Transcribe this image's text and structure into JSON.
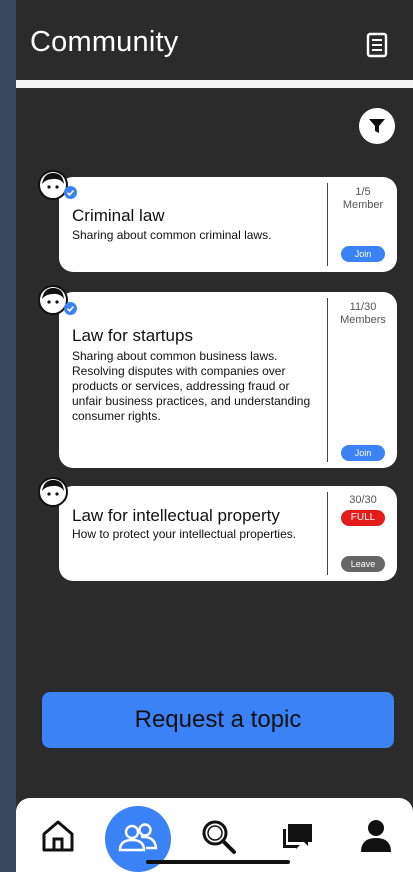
{
  "header": {
    "title": "Community"
  },
  "cards": [
    {
      "name": "Criminal law",
      "description": "Sharing about common criminal laws.",
      "count": "1/5",
      "count_unit": "Member",
      "action_label": "Join",
      "verified": true
    },
    {
      "name": "Law for startups",
      "description": "Sharing about common business laws. Resolving disputes with companies over products or services, addressing fraud or unfair business practices, and understanding consumer rights.",
      "count": "11/30",
      "count_unit": "Members",
      "action_label": "Join",
      "verified": true
    },
    {
      "name": "Law for intellectual property",
      "description": "How to protect your intellectual properties.",
      "count": "30/30",
      "status_badge": "FULL",
      "action_label": "Leave",
      "verified": false
    }
  ],
  "request_button": {
    "label": "Request a topic"
  },
  "nav": {
    "items": [
      {
        "icon": "home-icon"
      },
      {
        "icon": "community-icon",
        "active": true
      },
      {
        "icon": "search-icon"
      },
      {
        "icon": "chat-icon"
      },
      {
        "icon": "profile-icon"
      }
    ]
  },
  "colors": {
    "background": "#2b2b2b",
    "accent": "#3b82f6",
    "full_badge": "#e31b1b",
    "leave_button": "#666666"
  }
}
